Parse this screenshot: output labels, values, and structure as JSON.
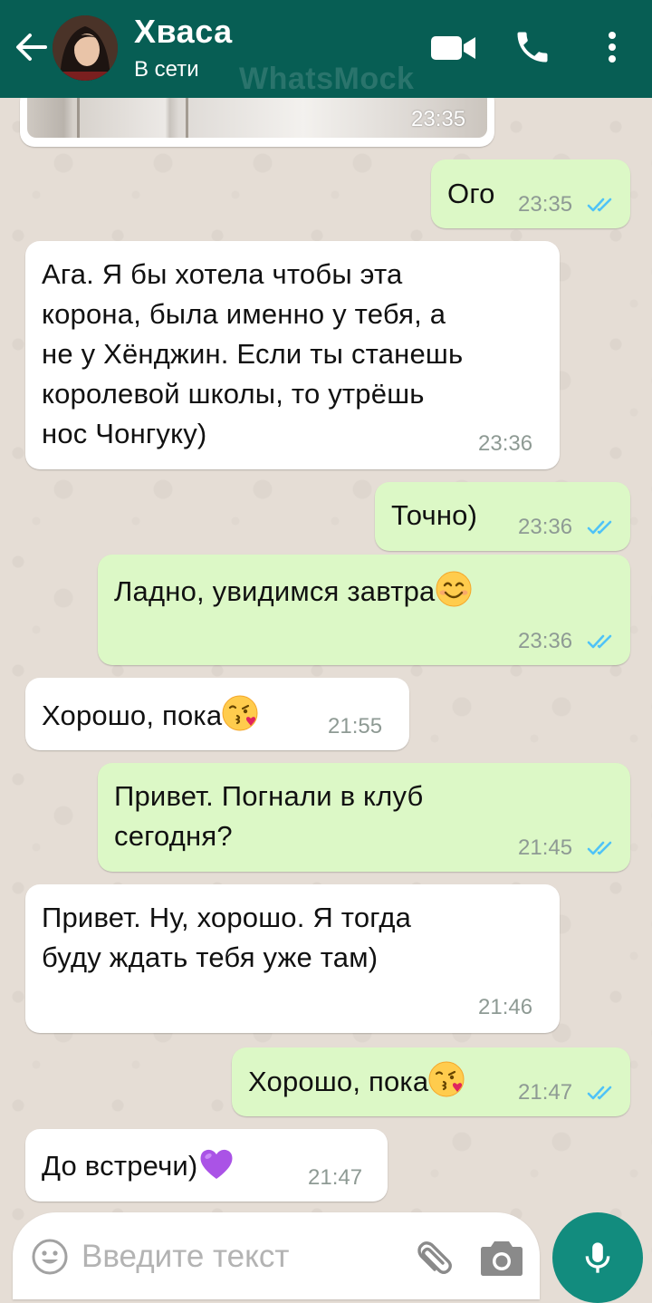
{
  "header": {
    "contact_name": "Хваса",
    "status": "В сети",
    "watermark": "WhatsMock"
  },
  "colors": {
    "header": "#075e54",
    "incoming_bubble": "#ffffff",
    "outgoing_bubble": "#dcf8c6",
    "read_ticks": "#4fc3f7",
    "mic_button": "#128c7e"
  },
  "messages": [
    {
      "direction": "in",
      "type": "image",
      "time": "23:35"
    },
    {
      "direction": "out",
      "text": "Ого",
      "time": "23:35",
      "status": "read"
    },
    {
      "direction": "in",
      "text": "Ага. Я бы хотела чтобы эта корона, была именно у тебя, а не у Хёнджин. Если ты станешь королевой школы, то утрёшь нос Чонгуку)",
      "time": "23:36"
    },
    {
      "direction": "out",
      "text": "Точно)",
      "time": "23:36",
      "status": "read"
    },
    {
      "direction": "out",
      "text": "Ладно, увидимся завтра",
      "emoji": "smiling-face",
      "time": "23:36",
      "status": "read"
    },
    {
      "direction": "in",
      "text": "Хорошо, пока",
      "emoji": "face-blowing-kiss",
      "time": "21:55"
    },
    {
      "direction": "out",
      "text": "Привет. Погнали в клуб сегодня?",
      "time": "21:45",
      "status": "read"
    },
    {
      "direction": "in",
      "text": "Привет. Ну, хорошо. Я тогда буду ждать тебя уже там)",
      "time": "21:46"
    },
    {
      "direction": "out",
      "text": "Хорошо, пока",
      "emoji": "face-blowing-kiss",
      "time": "21:47",
      "status": "read"
    },
    {
      "direction": "in",
      "text": "До встречи)",
      "emoji": "purple-heart",
      "time": "21:47"
    }
  ],
  "input": {
    "placeholder": "Введите текст",
    "value": ""
  },
  "icons": [
    "back-arrow-icon",
    "video-call-icon",
    "phone-icon",
    "more-vert-icon",
    "emoji-icon",
    "paperclip-icon",
    "camera-icon",
    "mic-icon",
    "double-check-icon"
  ]
}
